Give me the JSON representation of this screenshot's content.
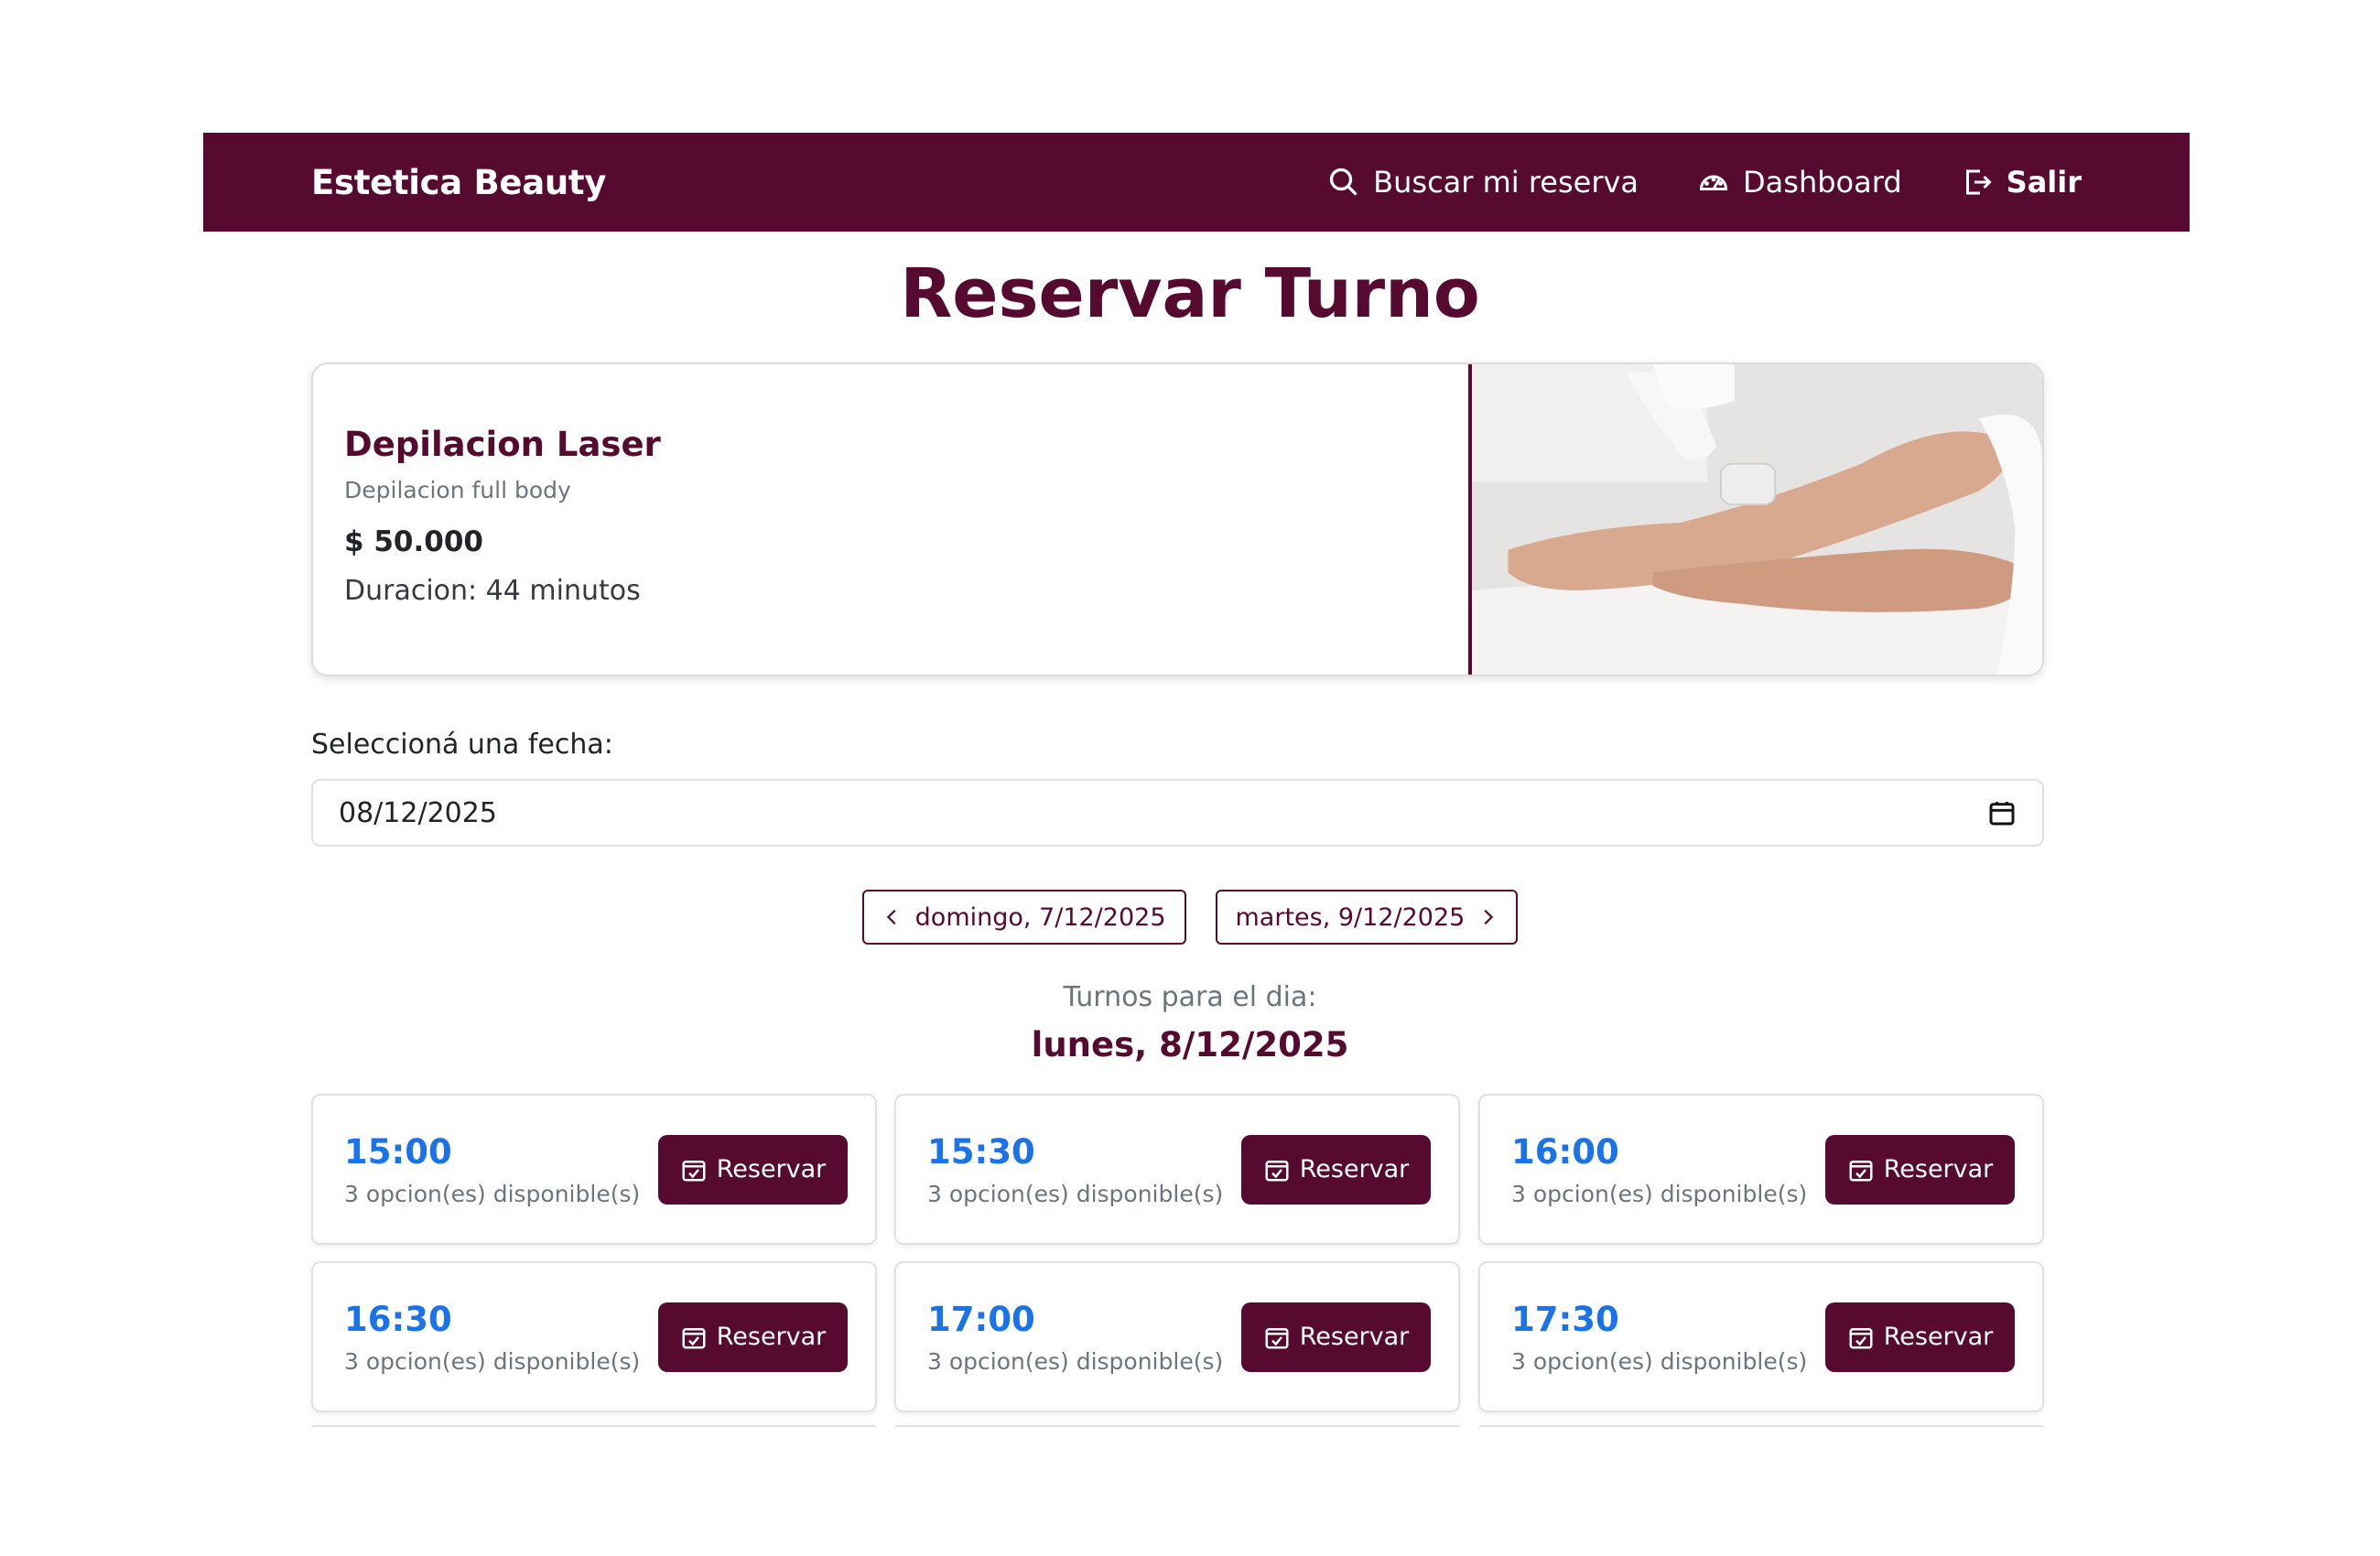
{
  "navbar": {
    "brand": "Estetica Beauty",
    "links": [
      {
        "label": "Buscar mi reserva",
        "icon": "search-icon"
      },
      {
        "label": "Dashboard",
        "icon": "speedometer-icon"
      },
      {
        "label": "Salir",
        "icon": "logout-icon"
      }
    ]
  },
  "page": {
    "title": "Reservar Turno"
  },
  "service": {
    "name": "Depilacion Laser",
    "description": "Depilacion full body",
    "price": "$ 50.000",
    "duration": "Duracion: 44 minutos"
  },
  "date_picker": {
    "label": "Seleccioná una fecha:",
    "value": "08/12/2025"
  },
  "day_nav": {
    "prev": "domingo, 7/12/2025",
    "next": "martes, 9/12/2025"
  },
  "turnos": {
    "label": "Turnos para el dia:",
    "date": "lunes, 8/12/2025",
    "button_label": "Reservar",
    "slots": [
      {
        "time": "15:00",
        "availability": "3 opcion(es) disponible(s)"
      },
      {
        "time": "15:30",
        "availability": "3 opcion(es) disponible(s)"
      },
      {
        "time": "16:00",
        "availability": "3 opcion(es) disponible(s)"
      },
      {
        "time": "16:30",
        "availability": "3 opcion(es) disponible(s)"
      },
      {
        "time": "17:00",
        "availability": "3 opcion(es) disponible(s)"
      },
      {
        "time": "17:30",
        "availability": "3 opcion(es) disponible(s)"
      }
    ]
  },
  "colors": {
    "brand": "#560a30",
    "time_accent": "#1a73e8"
  }
}
